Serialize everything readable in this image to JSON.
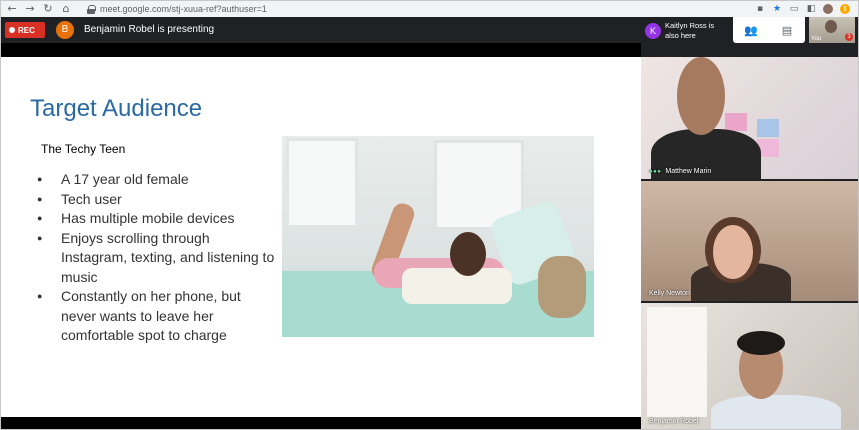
{
  "browser": {
    "url": "meet.google.com/stj-xuua-ref?authuser=1",
    "nav": {
      "back": "←",
      "forward": "→",
      "reload": "↻",
      "home": "⌂"
    },
    "icons": [
      "camera-icon",
      "star-icon",
      "cast-icon",
      "extension-icon",
      "profile-avatar-icon",
      "alert-icon"
    ]
  },
  "meet": {
    "rec_label": "REC",
    "presenter_initial": "B",
    "presenter_text": "Benjamin Robel is presenting",
    "also_here_initial": "K",
    "also_here_text": "Kaitlyn Ross is also here",
    "self_label": "You",
    "self_badge": "3",
    "controls": [
      "people-icon",
      "chat-icon"
    ]
  },
  "slide": {
    "title": "Target Audience",
    "subtitle": "The Techy Teen",
    "bullets": [
      "A 17 year old female",
      "Tech user",
      "Has multiple mobile devices",
      "Enjoys scrolling through Instagram, texting, and listening to music",
      "Constantly on her phone, but never wants to leave her comfortable spot to charge"
    ]
  },
  "participants": [
    {
      "name": "Matthew Marin"
    },
    {
      "name": "Kelly Newton"
    },
    {
      "name": "Benjamin Robel"
    }
  ],
  "colors": {
    "title": "#2a6aa3",
    "rec": "#d93025",
    "meet_bg": "#202124",
    "presenter_avatar": "#e8710a",
    "also_avatar": "#9334e6",
    "speaking_dots": "#6fe3a7"
  }
}
